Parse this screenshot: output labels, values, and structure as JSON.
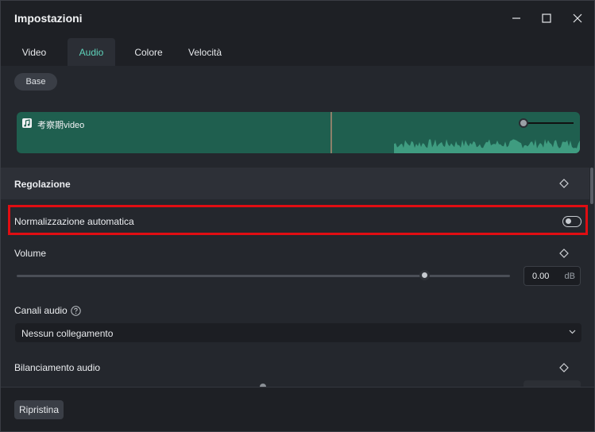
{
  "window": {
    "title": "Impostazioni"
  },
  "tabs": [
    {
      "label": "Video"
    },
    {
      "label": "Audio"
    },
    {
      "label": "Colore"
    },
    {
      "label": "Velocità"
    }
  ],
  "active_tab": "Audio",
  "subtab": {
    "label": "Base"
  },
  "track": {
    "name": "考察期video",
    "color": "#1f5f4f"
  },
  "section": {
    "title": "Regolazione"
  },
  "auto_normalize": {
    "label": "Normalizzazione automatica",
    "enabled": false
  },
  "volume": {
    "label": "Volume",
    "value": "0.00",
    "unit": "dB"
  },
  "audio_channels": {
    "label": "Canali audio",
    "selected": "Nessun collegamento"
  },
  "audio_balance": {
    "label": "Bilanciamento audio"
  },
  "footer": {
    "reset_label": "Ripristina"
  },
  "colors": {
    "accent": "#5fd3bb",
    "highlight_border": "#e00d12"
  }
}
